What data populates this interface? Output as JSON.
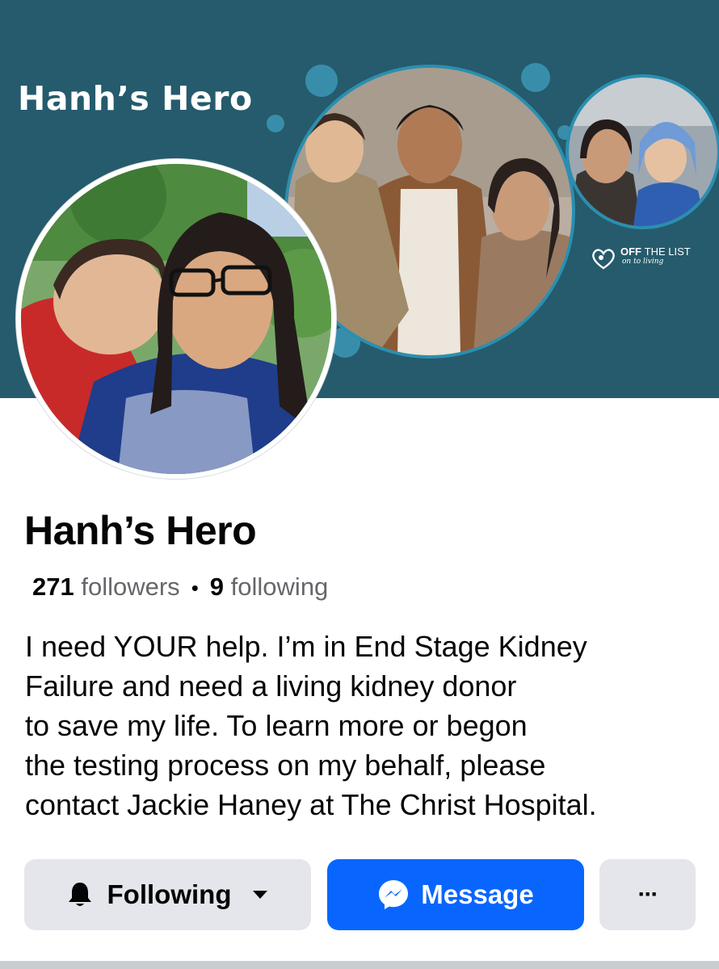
{
  "cover": {
    "title": "Hanh’s Hero",
    "logo_text_bold": "OFF",
    "logo_text_light": "THE LIST",
    "logo_tagline": "on to living",
    "background_color": "#255b6c",
    "bubble_color": "#3f9fbf"
  },
  "profile": {
    "name": "Hanh’s Hero",
    "followers_count": "271",
    "followers_label": "followers",
    "separator": "•",
    "following_count": "9",
    "following_label": "following",
    "bio_lines": [
      "I need YOUR help. I’m in End Stage Kidney",
      "Failure and need a living kidney donor",
      "to save my life. To learn more or begon",
      "the testing process on my behalf, please",
      "contact Jackie Haney at The Christ Hospital."
    ]
  },
  "actions": {
    "following_label": "Following",
    "message_label": "Message",
    "more_label": "···",
    "following_icon": "bell-icon",
    "dropdown_icon": "caret-down-icon",
    "message_icon": "messenger-icon",
    "accent_color": "#0866ff",
    "secondary_color": "#e4e6eb"
  }
}
